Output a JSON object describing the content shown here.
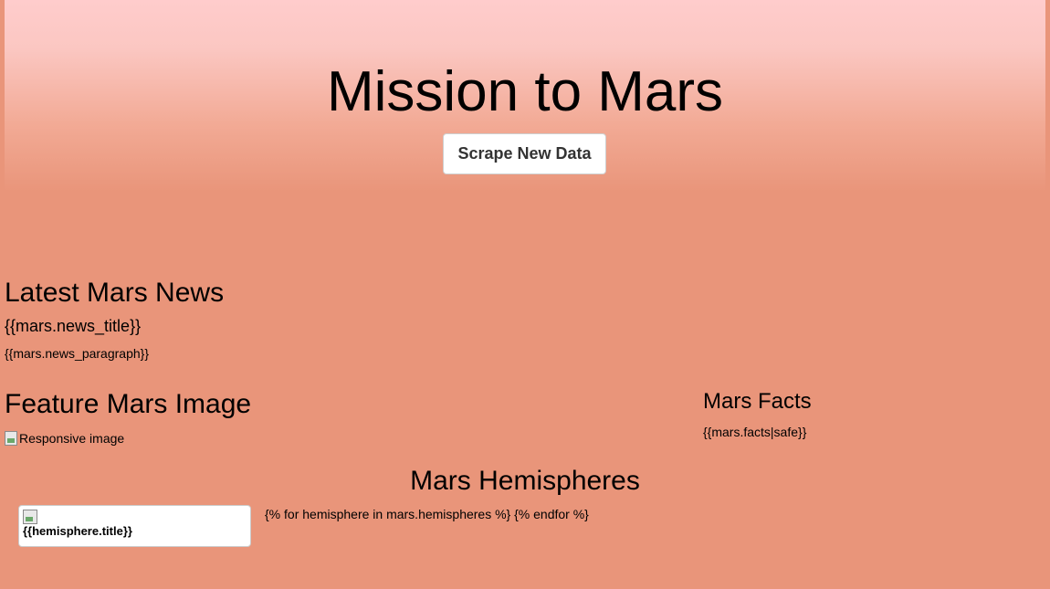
{
  "header": {
    "title": "Mission to Mars",
    "scrape_button_label": "Scrape New Data"
  },
  "news": {
    "heading": "Latest Mars News",
    "title": "{{mars.news_title}}",
    "paragraph": "{{mars.news_paragraph}}"
  },
  "featured_image": {
    "heading": "Feature Mars Image",
    "alt_text": "Responsive image"
  },
  "facts": {
    "heading": "Mars Facts",
    "table": "{{mars.facts|safe}}"
  },
  "hemispheres": {
    "heading": "Mars Hemispheres",
    "card_title": "{{hemisphere.title}}",
    "loop_text": "{% for hemisphere in mars.hemispheres %} {% endfor %}"
  },
  "colors": {
    "background": "#e9957a",
    "header_top": "#ffcccc"
  },
  "icons": {
    "broken_image": "broken-image-icon"
  }
}
